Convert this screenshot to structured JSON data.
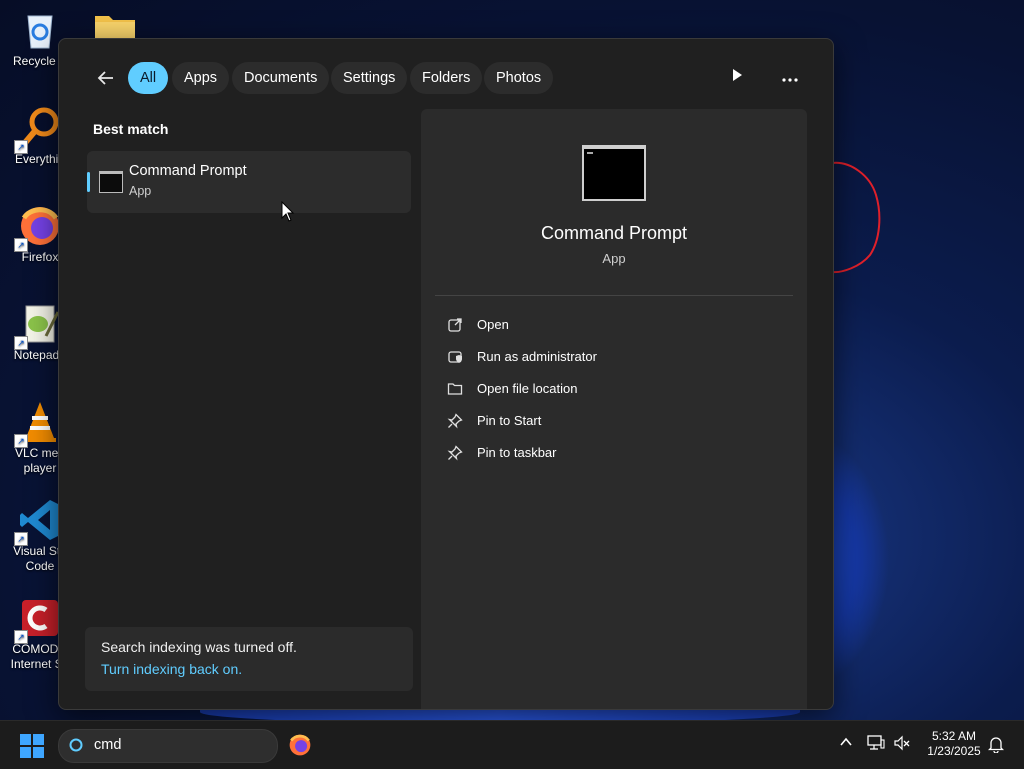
{
  "desktop": {
    "icons": [
      {
        "label": "Recycle B",
        "icon": "recycle-bin-icon"
      },
      {
        "label": "Everythin",
        "icon": "everything-search-icon"
      },
      {
        "label": "Firefox",
        "icon": "firefox-icon"
      },
      {
        "label": "Notepad+",
        "icon": "notepad-plus-plus-icon"
      },
      {
        "label": "VLC med player",
        "icon": "vlc-icon"
      },
      {
        "label": "Visual Stu Code",
        "icon": "vscode-icon"
      },
      {
        "label": "COMODO Internet Se",
        "icon": "comodo-icon"
      }
    ]
  },
  "search_flyout": {
    "filters": [
      "All",
      "Apps",
      "Documents",
      "Settings",
      "Folders",
      "Photos"
    ],
    "active_filter": "All",
    "best_match_heading": "Best match",
    "best_match": {
      "name": "Command Prompt",
      "type": "App",
      "icon": "command-prompt-icon"
    },
    "indexing_notice": {
      "message": "Search indexing was turned off.",
      "link": "Turn indexing back on."
    },
    "details": {
      "title": "Command Prompt",
      "type": "App",
      "actions": [
        {
          "label": "Open",
          "icon": "open-external-icon"
        },
        {
          "label": "Run as administrator",
          "icon": "shield-admin-icon"
        },
        {
          "label": "Open file location",
          "icon": "folder-icon"
        },
        {
          "label": "Pin to Start",
          "icon": "pin-icon"
        },
        {
          "label": "Pin to taskbar",
          "icon": "pin-icon"
        }
      ]
    }
  },
  "taskbar": {
    "search_value": "cmd",
    "clock": {
      "time": "5:32 AM",
      "date": "1/23/2025"
    }
  },
  "colors": {
    "accent": "#60cdff",
    "flyout_bg": "#202020",
    "panel_bg": "#2b2b2b"
  }
}
